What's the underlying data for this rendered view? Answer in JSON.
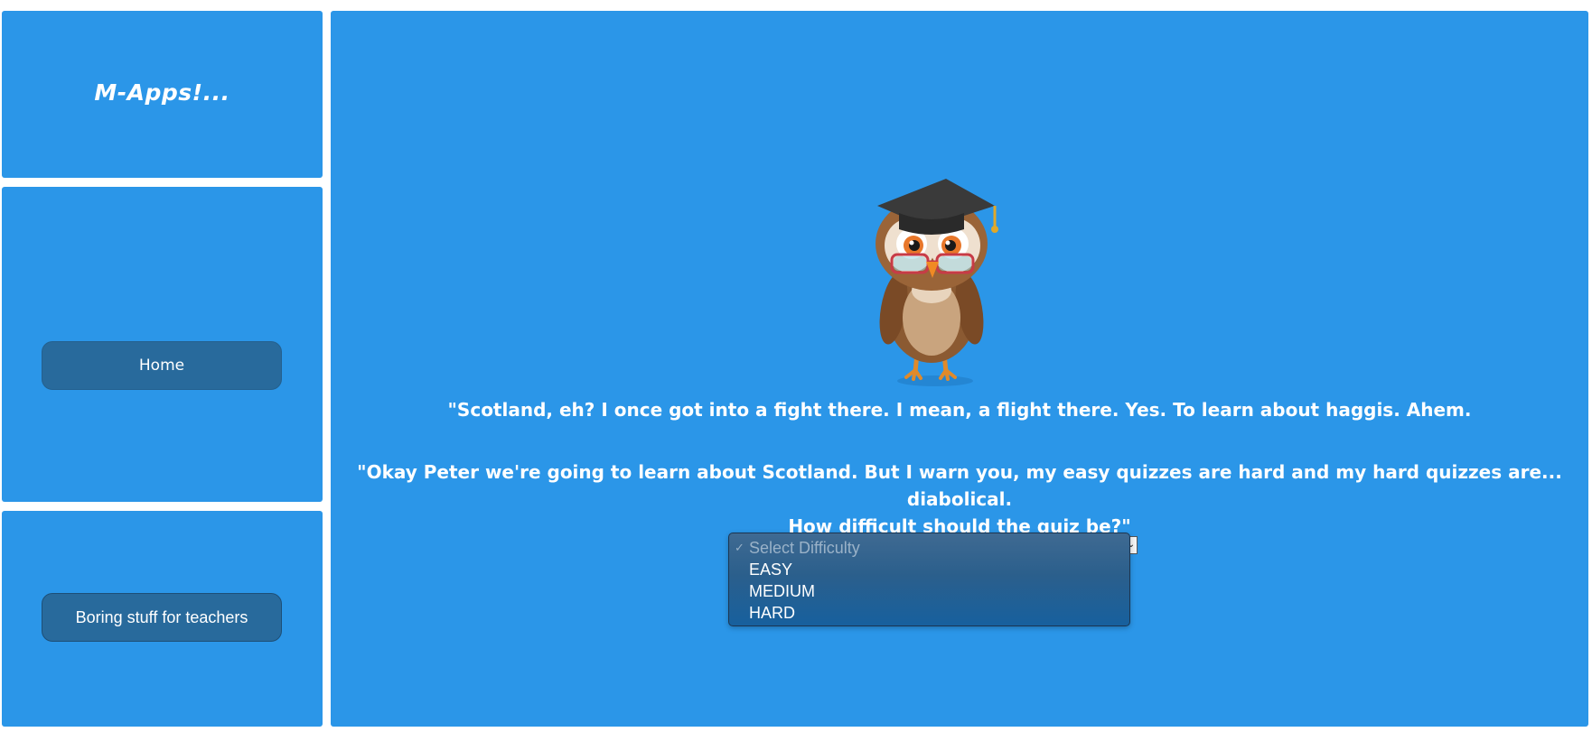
{
  "brand": {
    "title": "M-Apps!..."
  },
  "nav": {
    "home_label": "Home",
    "teachers_label": "Boring stuff for teachers"
  },
  "main": {
    "mascot_icon": "owl-graduate-icon",
    "speech_line_1": "\"Scotland, eh? I once got into a fight there. I mean, a flight there. Yes. To learn about haggis. Ahem.",
    "speech_line_2": "\"Okay Peter we're going to learn about Scotland. But I warn you, my easy quizzes are hard and my hard quizzes are... diabolical.",
    "speech_line_3": "How difficult should the quiz be?\""
  },
  "difficulty_select": {
    "check_mark": "✓",
    "options": [
      "Select Difficulty",
      "EASY",
      "MEDIUM",
      "HARD"
    ],
    "selected": "Select Difficulty"
  },
  "colors": {
    "panel_bg": "#2b96e8",
    "button_bg": "#286a9c",
    "text": "#ffffff"
  }
}
